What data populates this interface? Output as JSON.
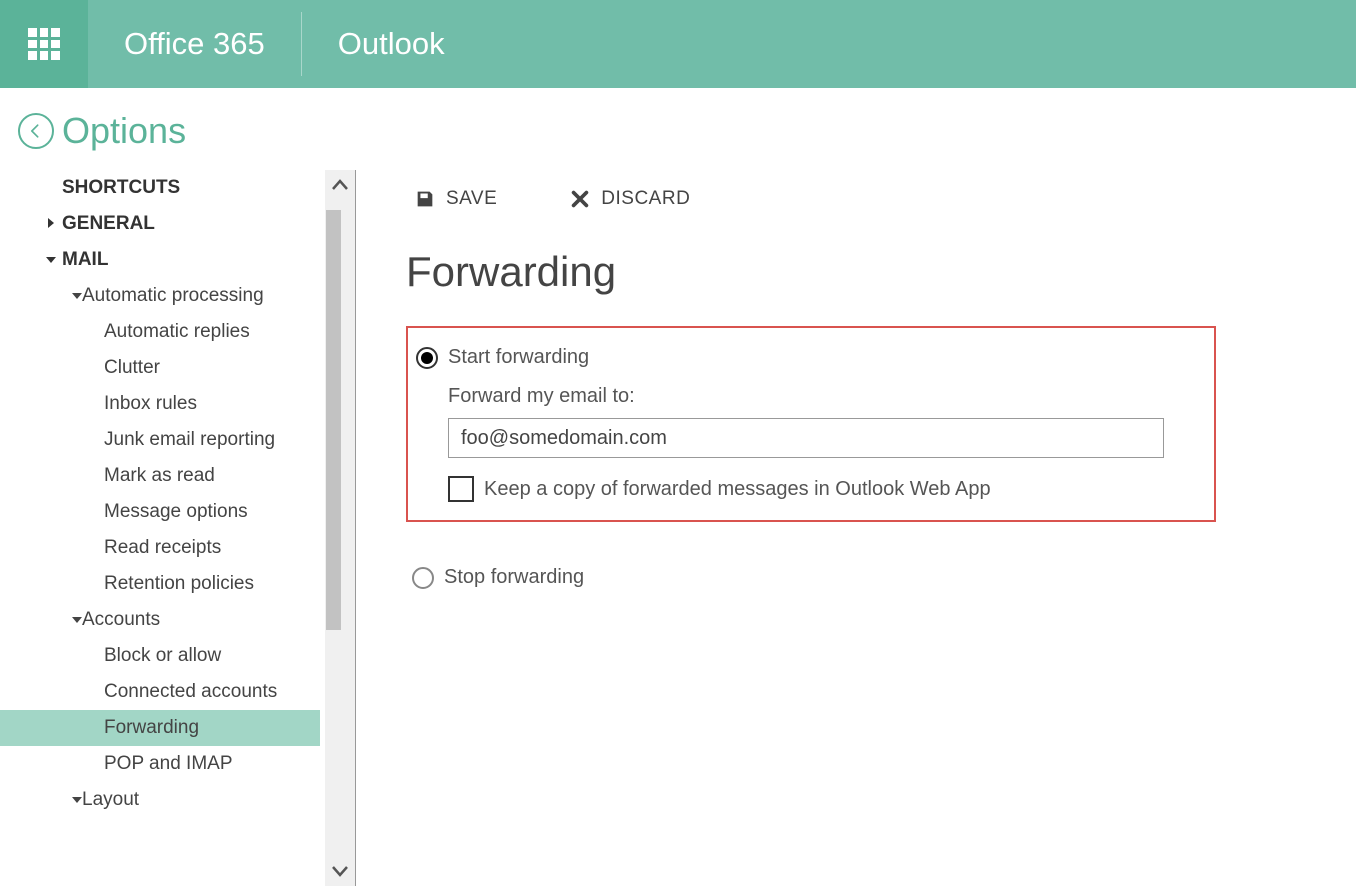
{
  "header": {
    "suite": "Office 365",
    "app": "Outlook"
  },
  "options": {
    "title": "Options"
  },
  "sidebar": {
    "shortcuts": "SHORTCUTS",
    "general": "GENERAL",
    "mail": "MAIL",
    "automaticProcessing": "Automatic processing",
    "automaticReplies": "Automatic replies",
    "clutter": "Clutter",
    "inboxRules": "Inbox rules",
    "junkEmailReporting": "Junk email reporting",
    "markAsRead": "Mark as read",
    "messageOptions": "Message options",
    "readReceipts": "Read receipts",
    "retentionPolicies": "Retention policies",
    "accounts": "Accounts",
    "blockOrAllow": "Block or allow",
    "connectedAccounts": "Connected accounts",
    "forwarding": "Forwarding",
    "popAndImap": "POP and IMAP",
    "layout": "Layout"
  },
  "toolbar": {
    "save": "SAVE",
    "discard": "DISCARD"
  },
  "page": {
    "heading": "Forwarding",
    "startForwarding": "Start forwarding",
    "forwardTo": "Forward my email to:",
    "emailValue": "foo@somedomain.com",
    "keepCopy": "Keep a copy of forwarded messages in Outlook Web App",
    "stopForwarding": "Stop forwarding"
  }
}
